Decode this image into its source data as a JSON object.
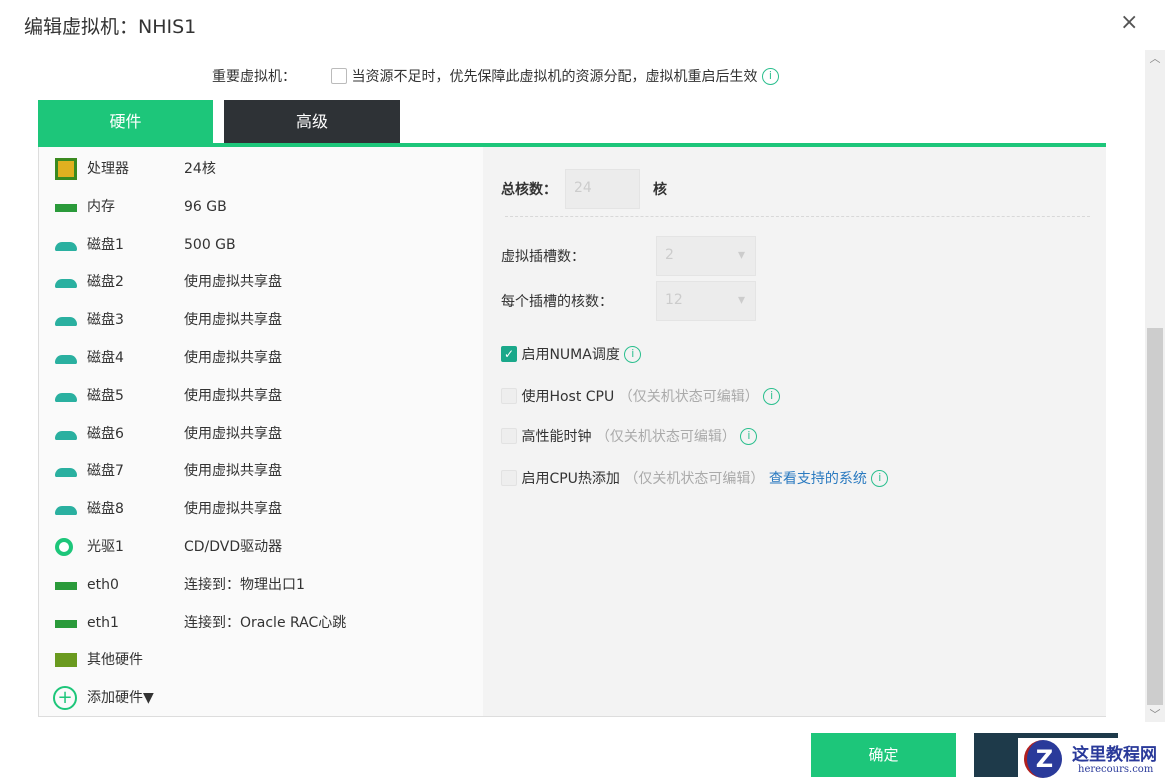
{
  "dialog": {
    "title": "编辑虚拟机：NHIS1",
    "close": "×"
  },
  "important": {
    "label": "重要虚拟机：",
    "text": "当资源不足时，优先保障此虚拟机的资源分配，虚拟机重启后生效",
    "checked": false
  },
  "tabs": [
    {
      "label": "硬件",
      "active": true
    },
    {
      "label": "高级",
      "active": false
    }
  ],
  "hardware": [
    {
      "icon": "cpu-icon",
      "name": "处理器",
      "value": "24核",
      "color": "#3a8a1f"
    },
    {
      "icon": "memory-icon",
      "name": "内存",
      "value": "96 GB",
      "color": "#2a9a3a"
    },
    {
      "icon": "disk-icon",
      "name": "磁盘1",
      "value": "500 GB",
      "color": "#2ab0a0"
    },
    {
      "icon": "disk-icon",
      "name": "磁盘2",
      "value": "使用虚拟共享盘",
      "color": "#2ab0a0"
    },
    {
      "icon": "disk-icon",
      "name": "磁盘3",
      "value": "使用虚拟共享盘",
      "color": "#2ab0a0"
    },
    {
      "icon": "disk-icon",
      "name": "磁盘4",
      "value": "使用虚拟共享盘",
      "color": "#2ab0a0"
    },
    {
      "icon": "disk-icon",
      "name": "磁盘5",
      "value": "使用虚拟共享盘",
      "color": "#2ab0a0"
    },
    {
      "icon": "disk-icon",
      "name": "磁盘6",
      "value": "使用虚拟共享盘",
      "color": "#2ab0a0"
    },
    {
      "icon": "disk-icon",
      "name": "磁盘7",
      "value": "使用虚拟共享盘",
      "color": "#2ab0a0"
    },
    {
      "icon": "disk-icon",
      "name": "磁盘8",
      "value": "使用虚拟共享盘",
      "color": "#2ab0a0"
    },
    {
      "icon": "cdrom-icon",
      "name": "光驱1",
      "value": "CD/DVD驱动器",
      "color": "#1dc67a"
    },
    {
      "icon": "nic-icon",
      "name": "eth0",
      "value": "连接到：物理出口1",
      "color": "#2a9a3a"
    },
    {
      "icon": "nic-icon",
      "name": "eth1",
      "value": "连接到：Oracle RAC心跳",
      "color": "#2a9a3a"
    },
    {
      "icon": "chip-icon",
      "name": "其他硬件",
      "value": "",
      "color": "#6a9a1f"
    }
  ],
  "add_hardware": "添加硬件▼",
  "cpu": {
    "total_label": "总核数：",
    "total_value": "24",
    "total_unit": "核",
    "sockets_label": "虚拟插槽数：",
    "sockets_value": "2",
    "cores_label": "每个插槽的核数：",
    "cores_value": "12",
    "options": [
      {
        "label": "启用NUMA调度",
        "note": "",
        "link": "",
        "checked": true
      },
      {
        "label": "使用Host CPU",
        "note": "（仅关机状态可编辑）",
        "link": "",
        "checked": false
      },
      {
        "label": "高性能时钟",
        "note": "（仅关机状态可编辑）",
        "link": "",
        "checked": false
      },
      {
        "label": "启用CPU热添加",
        "note": "（仅关机状态可编辑）",
        "link": "查看支持的系统",
        "checked": false
      }
    ]
  },
  "footer": {
    "ok": "确定",
    "cancel": ""
  },
  "watermark": {
    "name": "这里教程网",
    "url": "herecours.com"
  }
}
